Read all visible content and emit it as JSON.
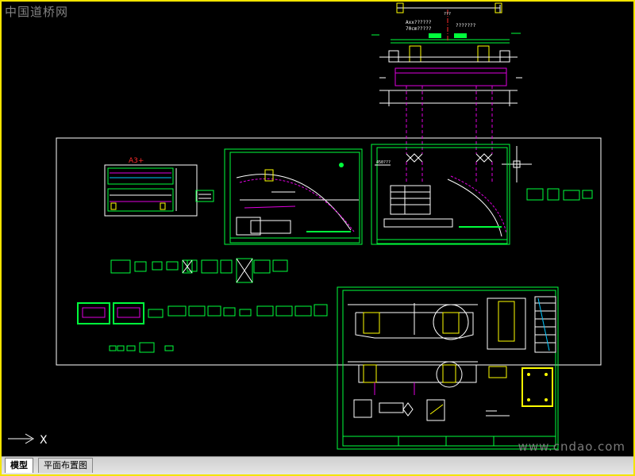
{
  "watermarks": {
    "top": "中国道桥网",
    "bottom": "www.cndao.com"
  },
  "drawing": {
    "sheet_label": "A3+",
    "dims": {
      "top_span": "???",
      "deck_left": "Axx??????",
      "deck_left2": "70cm?????",
      "deck_right": "???????",
      "pier_label": "450???"
    }
  },
  "ucs": {
    "axis_label": "X"
  },
  "tabs": [
    {
      "label": "模型"
    },
    {
      "label": "平面布置图"
    }
  ],
  "colors": {
    "background": "#000000",
    "frame": "#f3e400",
    "green": "#00ff3c",
    "magenta": "#e000e0",
    "white": "#ffffff",
    "yellow": "#ffff00",
    "cyan": "#00c8ff",
    "red": "#ff2a2a"
  }
}
